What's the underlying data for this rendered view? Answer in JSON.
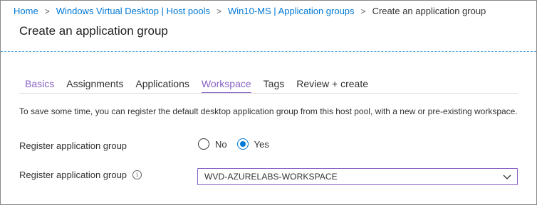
{
  "breadcrumb": {
    "items": [
      "Home",
      "Windows Virtual Desktop | Host pools",
      "Win10-MS | Application groups"
    ],
    "current": "Create an application group",
    "separator": ">"
  },
  "page": {
    "title": "Create an application group"
  },
  "tabs": [
    {
      "label": "Basics",
      "state": "visited"
    },
    {
      "label": "Assignments",
      "state": "default"
    },
    {
      "label": "Applications",
      "state": "default"
    },
    {
      "label": "Workspace",
      "state": "active"
    },
    {
      "label": "Tags",
      "state": "default"
    },
    {
      "label": "Review + create",
      "state": "default"
    }
  ],
  "form": {
    "description": "To save some time, you can register the default desktop application group from this host pool, with a new or pre-existing workspace.",
    "register_label": "Register application group",
    "register_options": [
      "No",
      "Yes"
    ],
    "register_selected": "Yes",
    "workspace_label": "Register application group",
    "info_icon": "i",
    "workspace_value": "WVD-AZURELABS-WORKSPACE"
  },
  "colors": {
    "link": "#0078d4",
    "accent_purple": "#8661c5",
    "radio_selected": "#0078d4"
  }
}
